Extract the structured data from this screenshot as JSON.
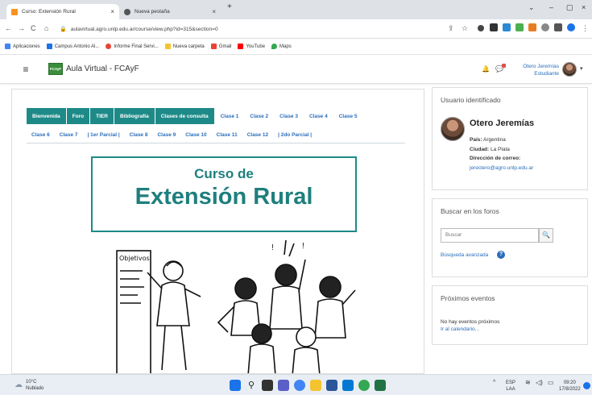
{
  "browser": {
    "tabs": [
      {
        "title": "Curso: Extensión Rural"
      },
      {
        "title": "Nueva pestaña"
      }
    ],
    "new_tab_symbol": "+",
    "address": "aulavirtual.agro.unlp.edu.ar/course/view.php?id=315&section=0",
    "bookmarks": [
      "Aplicaciones",
      "Campus Antonio Al...",
      "Informe Final Servi...",
      "Nueva carpeta",
      "Gmail",
      "YouTube",
      "Maps"
    ]
  },
  "header": {
    "menu_symbol": "≡",
    "logo_text": "FCAyF",
    "site_name": "Aula Virtual - FCAyF",
    "user_name": "Otero Jeremías",
    "user_role": "Estudiante"
  },
  "course_tabs": {
    "row1": [
      "Bienvenida",
      "Foro",
      "TIER",
      "Bibliografía",
      "Clases de consulta",
      "Clase 1",
      "Clase 2",
      "Clase 3",
      "Clase 4",
      "Clase 5"
    ],
    "row2": [
      "Clase 6",
      "Clase 7",
      "| 1er Parcial |",
      "Clase 8",
      "Clase 9",
      "Clase 10",
      "Clase 11",
      "Clase 12",
      "| 2do Parcial |"
    ]
  },
  "banner": {
    "line1": "Curso de",
    "line2": "Extensión Rural"
  },
  "blocks": {
    "user": {
      "title": "Usuario identificado",
      "name": "Otero Jeremías",
      "country_label": "País:",
      "country": "Argentina",
      "city_label": "Ciudad:",
      "city": "La Plata",
      "email_label": "Dirección de correo:",
      "email": "jerectero@agro.unlp.edu.ar"
    },
    "forum_search": {
      "title": "Buscar en los foros",
      "placeholder": "Buscar",
      "advanced": "Búsqueda avanzada"
    },
    "events": {
      "title": "Próximos eventos",
      "none": "No hay eventos próximos",
      "calendar": "Ir al calendario..."
    }
  },
  "illustration": {
    "board_text": "Objetivos"
  },
  "taskbar": {
    "temp": "10°C",
    "weather": "Nublado",
    "lang1": "ESP",
    "lang2": "LAA",
    "time": "09:20",
    "date": "17/8/2022"
  }
}
